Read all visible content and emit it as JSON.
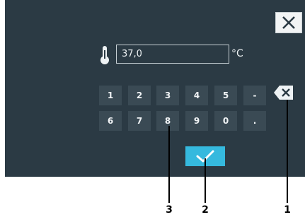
{
  "close": {
    "icon": "close-x-icon"
  },
  "temperature": {
    "icon": "thermometer-icon",
    "value": "37,0",
    "unit": "°C"
  },
  "keypad": {
    "row1": [
      "1",
      "2",
      "3",
      "4",
      "5",
      "-"
    ],
    "row2": [
      "6",
      "7",
      "8",
      "9",
      "0",
      "."
    ],
    "backspace_icon": "backspace-icon"
  },
  "confirm": {
    "icon": "checkmark-icon"
  },
  "callouts": [
    "1",
    "2",
    "3"
  ],
  "colors": {
    "panel": "#2b3a44",
    "key": "#3a4a54",
    "accent": "#35b9de"
  }
}
